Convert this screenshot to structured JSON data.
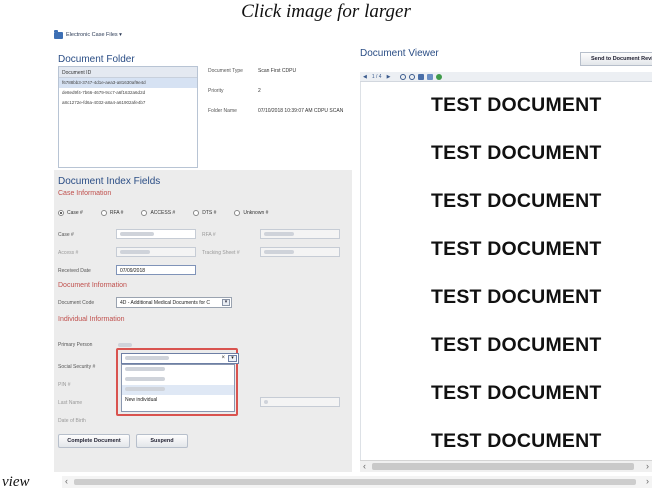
{
  "caption": "Click image for larger",
  "view_caption": "view",
  "app": {
    "menu": "Electronic Case Files ▾"
  },
  "document_folder": {
    "title": "Document Folder",
    "list_header": "Document ID",
    "rows": [
      "f6788bb3-3747-4d1e-aea3-a81630af9e4d",
      "de8ed9f4-7b66-4679-9cc7-a6f1632a6d2d",
      "a8c1272e-fd6a-4032-a8a4-a61902afe4b7"
    ],
    "meta": {
      "doc_type_label": "Document Type",
      "doc_type_value": "Scan First CDPU",
      "priority_label": "Priority",
      "priority_value": "2",
      "folder_name_label": "Folder Name",
      "folder_name_value": "07/10/2018 10:39:07 AM CDPU SCAN"
    }
  },
  "index_fields": {
    "title": "Document Index Fields",
    "case_info_title": "Case Information",
    "radios": [
      "Case #",
      "RFA #",
      "ACCESS #",
      "DTS #",
      "Unknown #"
    ],
    "selected_radio": "Case #",
    "case_label": "Case #",
    "rfa_label": "RFA #",
    "access_label": "Access #",
    "tracking_label": "Tracking Sheet #",
    "received_label": "Received Date",
    "received_value": "07/09/2018",
    "doc_info_title": "Document Information",
    "doc_code_label": "Document Code",
    "doc_code_value": "4D - Additional Medical Documents for C",
    "individual_title": "Individual Information",
    "primary_person_label": "Primary Person",
    "ssn_label": "Social Security #",
    "pin_label": "PIN #",
    "last_name_label": "Last Name",
    "dob_label": "Date of Birth",
    "ssn_clear": "×",
    "ssn_new_option": "New individual",
    "complete_button": "Complete Document",
    "suspend_button": "Suspend"
  },
  "viewer": {
    "title": "Document Viewer",
    "send_button": "Send to Document Review",
    "page_indicator": "1 / 4",
    "lines": [
      "TEST DOCUMENT",
      "TEST DOCUMENT",
      "TEST DOCUMENT",
      "TEST DOCUMENT",
      "TEST DOCUMENT",
      "TEST DOCUMENT",
      "TEST DOCUMENT",
      "TEST DOCUMENT"
    ]
  },
  "colors": {
    "section_title": "#2a4d85",
    "subsection": "#c0504d",
    "highlight_border": "#d9534f",
    "index_bg": "#ececec"
  }
}
